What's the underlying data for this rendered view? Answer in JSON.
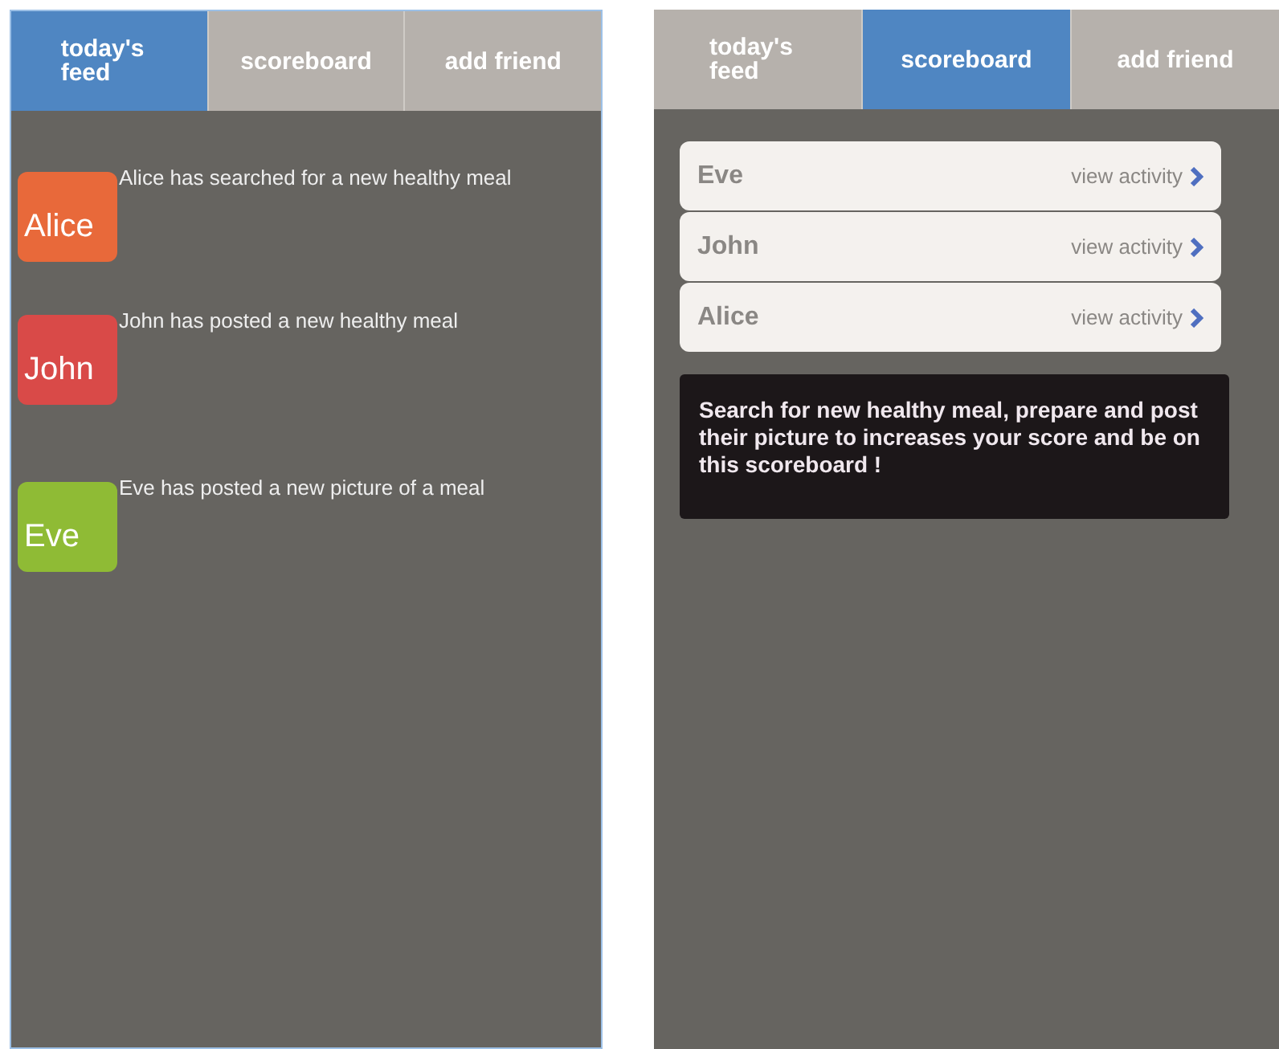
{
  "screens": [
    {
      "kind": "feed",
      "tabs": [
        {
          "label": "today's feed",
          "selected": true
        },
        {
          "label": "scoreboard",
          "selected": false
        },
        {
          "label": "add friend",
          "selected": false
        }
      ],
      "feed": [
        {
          "name": "Alice",
          "color": "#e8693a",
          "text": "Alice has searched for a new healthy meal"
        },
        {
          "name": "John",
          "color": "#d94a48",
          "text": "John has posted a new healthy meal"
        },
        {
          "name": "Eve",
          "color": "#8fbb35",
          "text": "Eve has posted a new picture of a meal"
        }
      ]
    },
    {
      "kind": "scoreboard",
      "tabs": [
        {
          "label": "today's feed",
          "selected": false
        },
        {
          "label": "scoreboard",
          "selected": true
        },
        {
          "label": "add friend",
          "selected": false
        }
      ],
      "rows": [
        {
          "name": "Eve",
          "link": "view activity"
        },
        {
          "name": "John",
          "link": "view activity"
        },
        {
          "name": "Alice",
          "link": "view activity"
        }
      ],
      "note": "Search for new healthy meal, prepare and post their picture to increases your score and be on this scoreboard !"
    }
  ]
}
